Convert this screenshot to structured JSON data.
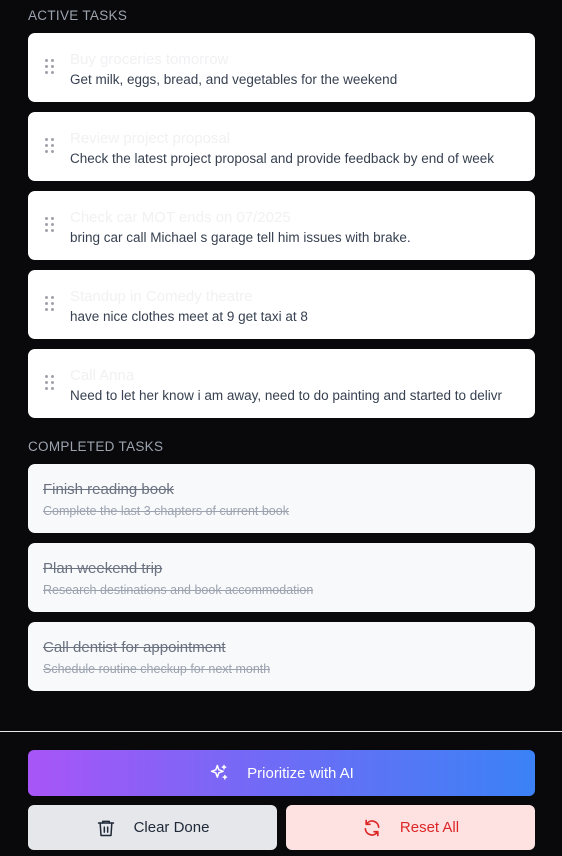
{
  "sections": {
    "active_label": "ACTIVE TASKS",
    "completed_label": "COMPLETED TASKS"
  },
  "active_tasks": [
    {
      "title": "Buy groceries tomorrow",
      "description": "Get milk, eggs, bread, and vegetables for the weekend"
    },
    {
      "title": "Review project proposal",
      "description": "Check the latest project proposal and provide feedback by end of week"
    },
    {
      "title": "Check car MOT ends on 07/2025",
      "description": "bring car call Michael s garage tell him issues with brake."
    },
    {
      "title": "Standup in Comedy theatre",
      "description": "have nice clothes meet at 9 get taxi at 8"
    },
    {
      "title": "Call Anna",
      "description": "Need to let her know i am away, need to do painting and started to delivr"
    }
  ],
  "completed_tasks": [
    {
      "title": "Finish reading book",
      "description": "Complete the last 3 chapters of current book"
    },
    {
      "title": "Plan weekend trip",
      "description": "Research destinations and book accommodation"
    },
    {
      "title": "Call dentist for appointment",
      "description": "Schedule routine checkup for next month"
    }
  ],
  "buttons": {
    "prioritize": "Prioritize with AI",
    "clear": "Clear Done",
    "reset": "Reset All"
  },
  "colors": {
    "background": "#09090b",
    "ai_gradient_start": "#a855f7",
    "ai_gradient_end": "#3b82f6",
    "reset_text": "#dc2626",
    "reset_bg": "#fee2e2"
  },
  "icons": {
    "drag_handle": "grip-vertical-icon",
    "prioritize": "sparkles-icon",
    "clear": "trash-icon",
    "reset": "refresh-icon"
  }
}
